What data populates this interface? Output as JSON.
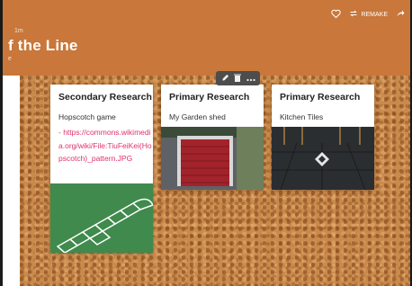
{
  "header": {
    "meta": "1m",
    "title": "f the Line",
    "subtitle": "e",
    "remake_label": "REMAKE",
    "background_color": "#c9773a"
  },
  "topbar": {
    "icons": [
      "heart-icon",
      "remake-icon",
      "share-icon"
    ]
  },
  "post_toolbar": {
    "icons": [
      "pencil-icon",
      "trash-icon",
      "more-icon"
    ]
  },
  "cards": [
    {
      "title": "Secondary Research",
      "subtitle": "Hopscotch game",
      "link": "- https://commons.wikimedia.org/wiki/File:TiuFeiKei(Hopscotch)_pattern.JPG"
    },
    {
      "title": "Primary Research",
      "subtitle": "My Garden shed"
    },
    {
      "title": "Primary Research",
      "subtitle": "Kitchen Tiles"
    }
  ],
  "colors": {
    "link": "#e0306a",
    "cork": "#c98a4c"
  }
}
